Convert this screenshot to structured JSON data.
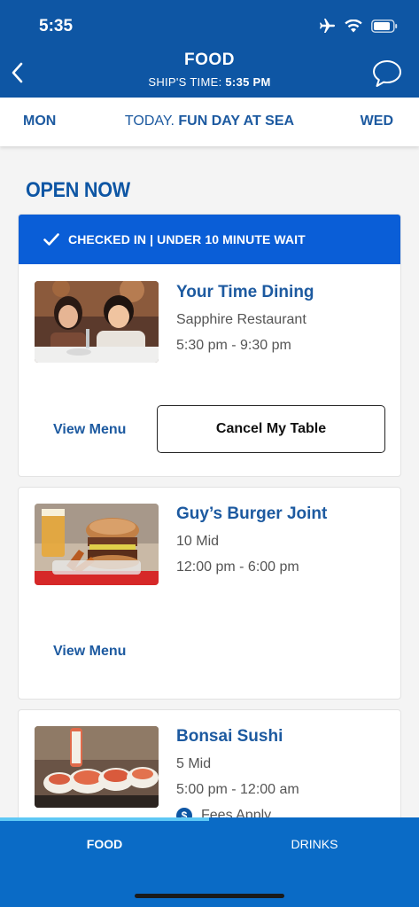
{
  "status_bar": {
    "time": "5:35"
  },
  "header": {
    "title": "FOOD",
    "ship_time_label": "SHIP'S TIME:",
    "ship_time_value": "5:35 PM"
  },
  "day_bar": {
    "prev": "MON",
    "today_prefix": "TODAY.",
    "today_name": "FUN DAY AT SEA",
    "next": "WED"
  },
  "section_title": "OPEN NOW",
  "venues": [
    {
      "banner": "CHECKED IN | UNDER 10 MINUTE WAIT",
      "name": "Your Time Dining",
      "location": "Sapphire Restaurant",
      "hours": "5:30 pm - 9:30 pm",
      "view_menu": "View Menu",
      "cancel": "Cancel My Table"
    },
    {
      "name": "Guy’s Burger Joint",
      "location": "10 Mid",
      "hours": "12:00 pm - 6:00 pm",
      "view_menu": "View Menu"
    },
    {
      "name": "Bonsai Sushi",
      "location": "5 Mid",
      "hours": "5:00 pm - 12:00 am",
      "fees": "Fees Apply",
      "fees_icon_glyph": "$"
    }
  ],
  "tabs": {
    "food": "FOOD",
    "drinks": "DRINKS"
  },
  "colors": {
    "brand_blue": "#0e56a4",
    "banner_blue": "#0a5ed7",
    "tabbar_blue": "#0a6bc6",
    "tab_indicator": "#5ec8f5"
  },
  "icons": [
    "back-chevron-icon",
    "chat-bubble-icon",
    "airplane-icon",
    "wifi-icon",
    "battery-icon",
    "checkmark-icon",
    "dollar-icon"
  ]
}
